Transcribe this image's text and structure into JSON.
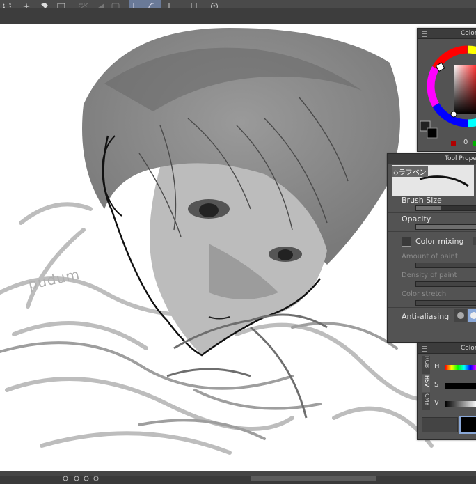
{
  "color_wheel_panel": {
    "title": "Color"
  },
  "tool_property": {
    "title": "Tool Proper",
    "brush_tag": "◇ラフペン",
    "brush_size_label": "Brush Size",
    "opacity_label": "Opacity",
    "color_mixing_label": "Color mixing",
    "amount_of_paint_label": "Amount of paint",
    "density_of_paint_label": "Density of paint",
    "color_stretch_label": "Color stretch",
    "anti_aliasing_label": "Anti-aliasing",
    "brush_size_level": 0.35,
    "opacity_level": 1.0
  },
  "color_slider_panel": {
    "title": "Color",
    "tabs": [
      "RGB",
      "HSV",
      "CMY"
    ],
    "h_label": "H",
    "s_label": "S",
    "v_label": "V"
  },
  "color_wheel_extra": {
    "zero_label": "0"
  },
  "canvas": {
    "signature": "pudum"
  },
  "colors": {
    "panel_bg": "#535353",
    "hue_red": "#ff0000",
    "selected_highlight": "#8aa8d8"
  },
  "icons": [
    "lasso-icon",
    "brush-icon",
    "bucket-icon",
    "transform-icon",
    "ruler-icon",
    "phone-icon",
    "help-icon"
  ]
}
